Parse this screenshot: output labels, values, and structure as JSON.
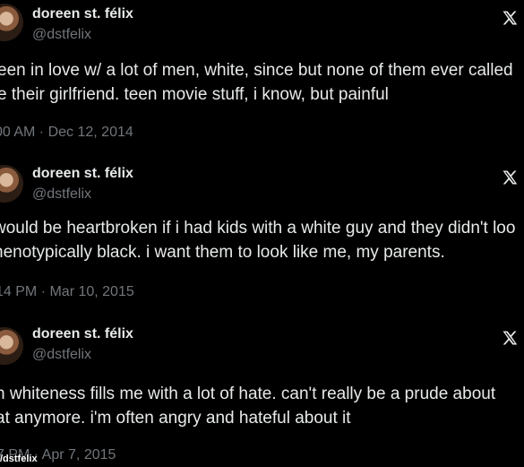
{
  "colors": {
    "background": "#000000",
    "primary_text": "#e7e9ea",
    "secondary_text": "#71767b"
  },
  "tweets": [
    {
      "display_name": "doreen st. félix",
      "handle": "@dstfelix",
      "text_lines": [
        "een in love w/ a lot of men, white, since but none of them ever called",
        "e their girlfriend. teen movie stuff, i know, but painful"
      ],
      "timestamp": "00 AM · Dec 12, 2014",
      "icon": "x-logo-icon"
    },
    {
      "display_name": "doreen st. félix",
      "handle": "@dstfelix",
      "text_lines": [
        "would be heartbroken if i had kids with a white guy and they didn't loo",
        "henotypically black. i want them to look like me, my parents."
      ],
      "timestamp": "14 PM · Mar 10, 2015",
      "icon": "x-logo-icon"
    },
    {
      "display_name": "doreen st. félix",
      "handle": "@dstfelix",
      "text_lines": [
        "h whiteness fills me with a lot of hate. can't really be a prude about",
        "at anymore. i'm often angry and hateful about it"
      ],
      "timestamp": "7 PM · Apr 7, 2015",
      "icon": "x-logo-icon"
    }
  ],
  "watermark": "/dstfelix"
}
